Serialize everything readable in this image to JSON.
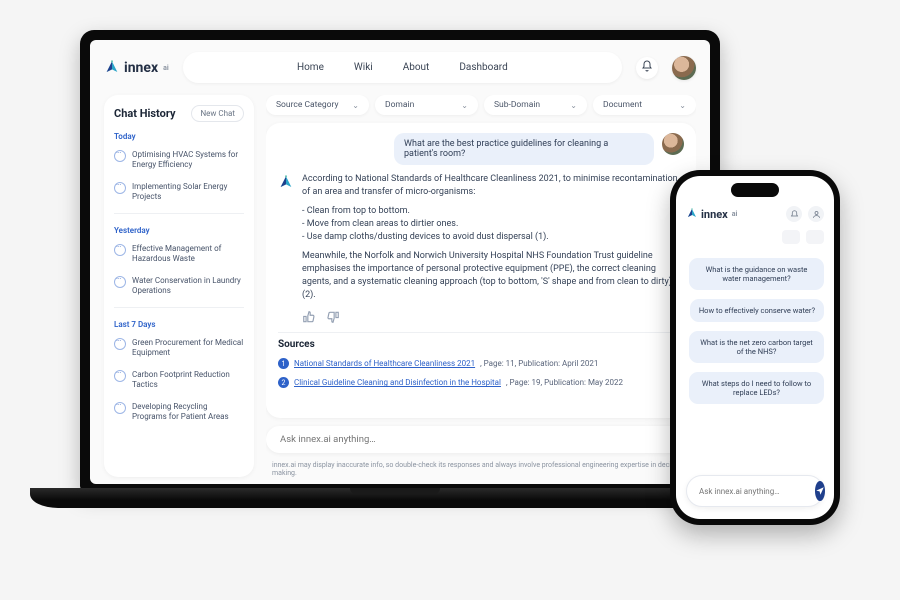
{
  "brand": {
    "name": "innex",
    "suffix": "ai"
  },
  "nav": {
    "items": [
      "Home",
      "Wiki",
      "About",
      "Dashboard"
    ]
  },
  "sidebar": {
    "title": "Chat History",
    "new_chat": "New Chat",
    "groups": [
      {
        "label": "Today",
        "items": [
          "Optimising HVAC Systems for Energy Efficiency",
          "Implementing Solar Energy Projects"
        ]
      },
      {
        "label": "Yesterday",
        "items": [
          "Effective Management of Hazardous Waste",
          "Water Conservation in Laundry Operations"
        ]
      },
      {
        "label": "Last 7 Days",
        "items": [
          "Green Procurement for Medical Equipment",
          "Carbon Footprint Reduction Tactics",
          "Developing Recycling Programs for Patient Areas"
        ]
      }
    ]
  },
  "filters": [
    {
      "label": "Source Category"
    },
    {
      "label": "Domain"
    },
    {
      "label": "Sub-Domain"
    },
    {
      "label": "Document"
    }
  ],
  "chat": {
    "user_question": "What are the best practice guidelines for cleaning a patient's room?",
    "answer_p1": "According to National Standards of Healthcare Cleanliness 2021, to minimise recontamination of an area and transfer of micro-organisms:",
    "answer_b1": "- Clean from top to bottom.",
    "answer_b2": "- Move from clean areas to dirtier ones.",
    "answer_b3": "- Use damp cloths/dusting devices to avoid dust dispersal (1).",
    "answer_p2": "Meanwhile, the Norfolk and Norwich University Hospital NHS Foundation Trust guideline emphasises the importance of personal protective equipment (PPE),  the correct cleaning agents, and a systematic cleaning approach (top to bottom, 'S' shape and from clean to dirty) (2).",
    "sources_label": "Sources",
    "sources": [
      {
        "num": "1",
        "title": "National Standards of Healthcare Cleanliness 2021",
        "meta": ", Page: 11, Publication: April 2021"
      },
      {
        "num": "2",
        "title": "Clinical Guideline Cleaning and Disinfection in the Hospital",
        "meta": ", Page: 19, Publication:  May 2022"
      }
    ]
  },
  "prompt": {
    "placeholder": "Ask innex.ai anything…"
  },
  "disclaimer": "innex.ai may display inaccurate info, so double-check its responses and always involve professional engineering expertise in decision-making.",
  "phone": {
    "bubbles": [
      "What is the guidance on waste water management?",
      "How to effectively conserve water?",
      "What is the net zero carbon target of the NHS?",
      "What steps do I need to follow to replace LEDs?"
    ],
    "prompt_placeholder": "Ask innex.ai anything…"
  }
}
